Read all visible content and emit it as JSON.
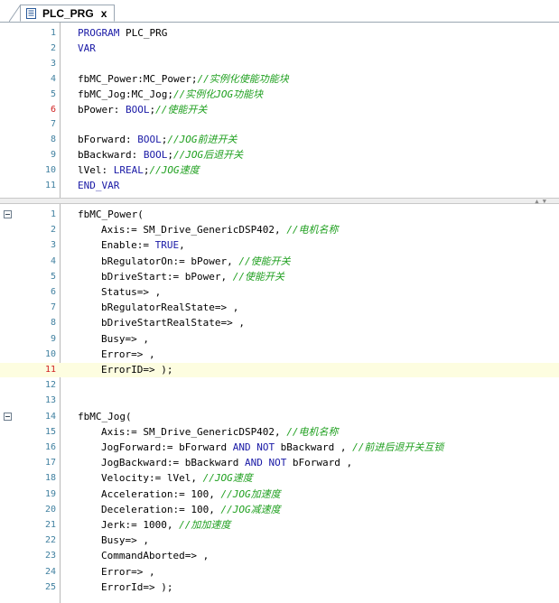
{
  "tab": {
    "title": "PLC_PRG",
    "close": "x"
  },
  "declaration": [
    {
      "n": "1",
      "indent": 0,
      "parts": [
        [
          "kw",
          "PROGRAM"
        ],
        [
          "id",
          " PLC_PRG"
        ]
      ]
    },
    {
      "n": "2",
      "indent": 0,
      "parts": [
        [
          "kw",
          "VAR"
        ]
      ]
    },
    {
      "n": "3",
      "indent": 0,
      "parts": []
    },
    {
      "n": "4",
      "indent": 0,
      "parts": [
        [
          "id",
          "fbMC_Power:MC_Power;"
        ],
        [
          "cm",
          "//实例化使能功能块"
        ]
      ]
    },
    {
      "n": "5",
      "indent": 0,
      "parts": [
        [
          "id",
          "fbMC_Jog:MC_Jog;"
        ],
        [
          "cm",
          "//实例化JOG功能块"
        ]
      ]
    },
    {
      "n": "6",
      "indent": 0,
      "err": true,
      "parts": [
        [
          "id",
          "bPower: "
        ],
        [
          "kw",
          "BOOL"
        ],
        [
          "id",
          ";"
        ],
        [
          "cm",
          "//使能开关"
        ]
      ]
    },
    {
      "n": "7",
      "indent": 0,
      "parts": []
    },
    {
      "n": "8",
      "indent": 0,
      "parts": [
        [
          "id",
          "bForward: "
        ],
        [
          "kw",
          "BOOL"
        ],
        [
          "id",
          ";"
        ],
        [
          "cm",
          "//JOG前进开关"
        ]
      ]
    },
    {
      "n": "9",
      "indent": 0,
      "parts": [
        [
          "id",
          "bBackward: "
        ],
        [
          "kw",
          "BOOL"
        ],
        [
          "id",
          ";"
        ],
        [
          "cm",
          "//JOG后退开关"
        ]
      ]
    },
    {
      "n": "10",
      "indent": 0,
      "parts": [
        [
          "id",
          "lVel: "
        ],
        [
          "kw",
          "LREAL"
        ],
        [
          "id",
          ";"
        ],
        [
          "cm",
          "//JOG速度"
        ]
      ]
    },
    {
      "n": "11",
      "indent": 0,
      "parts": [
        [
          "kw",
          "END_VAR"
        ]
      ]
    }
  ],
  "implementation": [
    {
      "n": "1",
      "indent": 0,
      "fold": true,
      "parts": [
        [
          "id",
          "fbMC_Power("
        ]
      ]
    },
    {
      "n": "2",
      "indent": 1,
      "parts": [
        [
          "id",
          "Axis:= SM_Drive_GenericDSP402, "
        ],
        [
          "cm",
          "//电机名称"
        ]
      ]
    },
    {
      "n": "3",
      "indent": 1,
      "parts": [
        [
          "id",
          "Enable:= "
        ],
        [
          "kw",
          "TRUE"
        ],
        [
          "id",
          ","
        ]
      ]
    },
    {
      "n": "4",
      "indent": 1,
      "parts": [
        [
          "id",
          "bRegulatorOn:= bPower, "
        ],
        [
          "cm",
          "//使能开关"
        ]
      ]
    },
    {
      "n": "5",
      "indent": 1,
      "parts": [
        [
          "id",
          "bDriveStart:= bPower, "
        ],
        [
          "cm",
          "//使能开关"
        ]
      ]
    },
    {
      "n": "6",
      "indent": 1,
      "parts": [
        [
          "id",
          "Status=> ,"
        ]
      ]
    },
    {
      "n": "7",
      "indent": 1,
      "parts": [
        [
          "id",
          "bRegulatorRealState=> ,"
        ]
      ]
    },
    {
      "n": "8",
      "indent": 1,
      "parts": [
        [
          "id",
          "bDriveStartRealState=> ,"
        ]
      ]
    },
    {
      "n": "9",
      "indent": 1,
      "parts": [
        [
          "id",
          "Busy=> ,"
        ]
      ]
    },
    {
      "n": "10",
      "indent": 1,
      "parts": [
        [
          "id",
          "Error=> ,"
        ]
      ]
    },
    {
      "n": "11",
      "indent": 1,
      "err": true,
      "hl": true,
      "parts": [
        [
          "id",
          "ErrorID=> );"
        ]
      ]
    },
    {
      "n": "12",
      "indent": 0,
      "parts": []
    },
    {
      "n": "13",
      "indent": 0,
      "parts": []
    },
    {
      "n": "14",
      "indent": 0,
      "fold": true,
      "parts": [
        [
          "id",
          "fbMC_Jog("
        ]
      ]
    },
    {
      "n": "15",
      "indent": 1,
      "parts": [
        [
          "id",
          "Axis:= SM_Drive_GenericDSP402, "
        ],
        [
          "cm",
          "//电机名称"
        ]
      ]
    },
    {
      "n": "16",
      "indent": 1,
      "parts": [
        [
          "id",
          "JogForward:= bForward "
        ],
        [
          "kw",
          "AND NOT"
        ],
        [
          "id",
          " bBackward , "
        ],
        [
          "cm",
          "//前进后退开关互锁"
        ]
      ]
    },
    {
      "n": "17",
      "indent": 1,
      "parts": [
        [
          "id",
          "JogBackward:= bBackward "
        ],
        [
          "kw",
          "AND NOT"
        ],
        [
          "id",
          " bForward ,"
        ]
      ]
    },
    {
      "n": "18",
      "indent": 1,
      "parts": [
        [
          "id",
          "Velocity:= lVel, "
        ],
        [
          "cm",
          "//JOG速度"
        ]
      ]
    },
    {
      "n": "19",
      "indent": 1,
      "parts": [
        [
          "id",
          "Acceleration:= 100, "
        ],
        [
          "cm",
          "//JOG加速度"
        ]
      ]
    },
    {
      "n": "20",
      "indent": 1,
      "parts": [
        [
          "id",
          "Deceleration:= 100, "
        ],
        [
          "cm",
          "//JOG减速度"
        ]
      ]
    },
    {
      "n": "21",
      "indent": 1,
      "parts": [
        [
          "id",
          "Jerk:= 1000, "
        ],
        [
          "cm",
          "//加加速度"
        ]
      ]
    },
    {
      "n": "22",
      "indent": 1,
      "parts": [
        [
          "id",
          "Busy=> ,"
        ]
      ]
    },
    {
      "n": "23",
      "indent": 1,
      "parts": [
        [
          "id",
          "CommandAborted=> ,"
        ]
      ]
    },
    {
      "n": "24",
      "indent": 1,
      "parts": [
        [
          "id",
          "Error=> ,"
        ]
      ]
    },
    {
      "n": "25",
      "indent": 1,
      "parts": [
        [
          "id",
          "ErrorId=> );"
        ]
      ]
    }
  ],
  "colors": {
    "keyword": "#1a1aa6",
    "comment": "#20a020",
    "line_number": "#4080a0",
    "error_line_number": "#d02020",
    "highlight": "#fdfde0"
  },
  "icons": {
    "tab": "document-icon",
    "fold": "collapse-icon"
  }
}
